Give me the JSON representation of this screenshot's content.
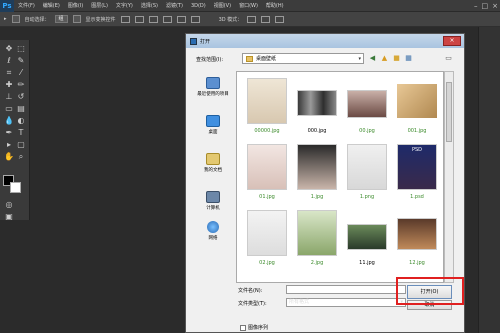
{
  "app": {
    "logo": "Ps"
  },
  "menu": [
    "文件(F)",
    "编辑(E)",
    "图像(I)",
    "图层(L)",
    "文字(Y)",
    "选择(S)",
    "滤镜(T)",
    "3D(D)",
    "视图(V)",
    "窗口(W)",
    "帮助(H)"
  ],
  "window_controls": [
    "–",
    "□",
    "×"
  ],
  "options": {
    "auto_select_label": "自动选择：",
    "auto_select_value": "组",
    "transform_label": "显示变换控件",
    "mode_3d": "3D 模式："
  },
  "dialog": {
    "title": "打开",
    "close": "×",
    "lookin_label": "查找范围(I):",
    "lookin_value": "桌面壁纸",
    "places": [
      {
        "icon": "recent-places-icon",
        "label": "最近使用的项目"
      },
      {
        "icon": "desktop-icon",
        "label": "桌面"
      },
      {
        "icon": "documents-icon",
        "label": "我的文档"
      },
      {
        "icon": "computer-icon",
        "label": "计算机"
      },
      {
        "icon": "network-icon",
        "label": "网络"
      }
    ],
    "files": [
      {
        "name": "00000.jpg",
        "selected": false
      },
      {
        "name": "000.jpg",
        "selected": false
      },
      {
        "name": "00.jpg",
        "selected": false
      },
      {
        "name": "001.jpg",
        "selected": false
      },
      {
        "name": "01.jpg",
        "selected": false
      },
      {
        "name": "1.jpg",
        "selected": false
      },
      {
        "name": "1.png",
        "selected": false
      },
      {
        "name": "1.psd",
        "selected": false
      },
      {
        "name": "02.jpg",
        "selected": false
      },
      {
        "name": "2.jpg",
        "selected": false
      },
      {
        "name": "11.jpg",
        "selected": false
      },
      {
        "name": "12.jpg",
        "selected": false
      }
    ],
    "psd_badge": "PSD",
    "filename_label": "文件名(N):",
    "filename_value": "",
    "filetype_label": "文件类型(T):",
    "filetype_value": "所有格式",
    "open_label": "打开(O)",
    "cancel_label": "取消",
    "image_sequence_label": "图像序列"
  },
  "colors": {
    "accent_highlight": "#e02020",
    "file_label": "#3a8a2a",
    "ps_blue": "#31a8ff"
  }
}
